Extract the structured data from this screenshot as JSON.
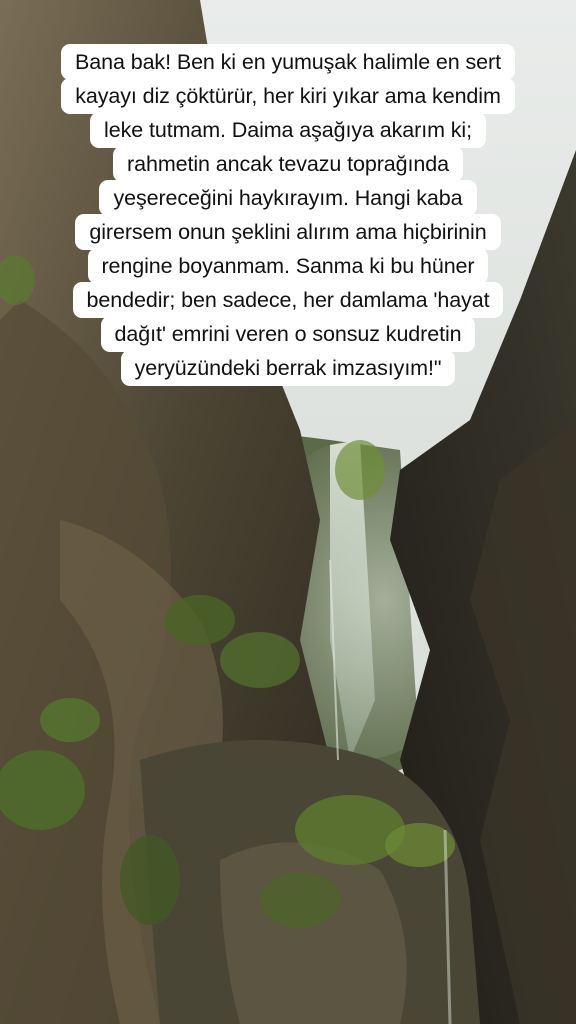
{
  "caption": {
    "lines": [
      "Bana bak! Ben ki en yumuşak halimle en sert",
      "kayayı diz çöktürür, her kiri yıkar ama kendim",
      "leke tutmam. Daima aşağıya akarım ki;",
      "rahmetin ancak tevazu toprağında",
      "yeşereceğini haykırayım. Hangi kaba",
      "girersem onun şeklini alırım ama hiçbirinin",
      "rengine boyanmam. Sanma ki bu hüner",
      "bendedir; ben sadece, her damlama 'hayat",
      "dağıt' emrini veren o sonsuz kudretin",
      "yeryüzündeki berrak imzasıyım!\""
    ]
  },
  "colors": {
    "caption_background": "#ffffff",
    "caption_text": "#111111",
    "sky": "#dfe3e0",
    "rock_dark": "#3b3528",
    "rock_mid": "#6e6450",
    "moss": "#4f6b2a",
    "waterfall": "#c9d6c8"
  }
}
